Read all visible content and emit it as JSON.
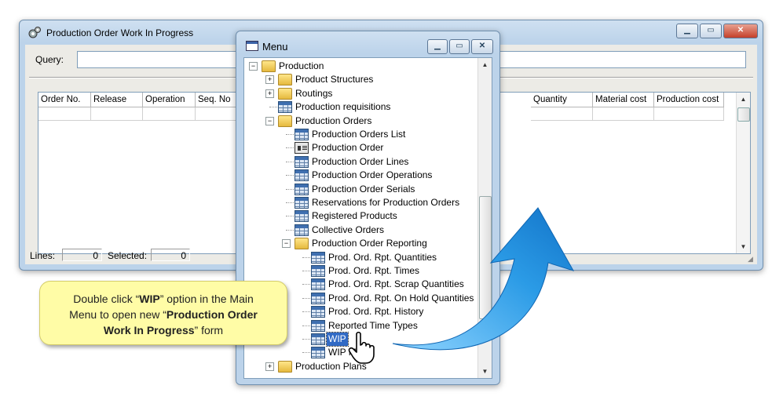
{
  "main_window": {
    "title": "Production Order Work In Progress",
    "caption_buttons": [
      "minimize",
      "maximize",
      "close"
    ],
    "query_label": "Query:",
    "query_value": "",
    "columns_left": [
      "Order No.",
      "Release",
      "Operation",
      "Seq. No"
    ],
    "columns_right": [
      "Quantity",
      "Material cost",
      "Production cost"
    ],
    "status": {
      "lines_label": "Lines:",
      "lines_value": "0",
      "selected_label": "Selected:",
      "selected_value": "0"
    }
  },
  "menu_window": {
    "title": "Menu",
    "items": [
      {
        "label": "Production",
        "icon": "folder-open-icon",
        "expander": "−",
        "level": 0
      },
      {
        "label": "Product Structures",
        "icon": "folder-icon",
        "expander": "+",
        "level": 1
      },
      {
        "label": "Routings",
        "icon": "folder-icon",
        "expander": "+",
        "level": 1
      },
      {
        "label": "Production requisitions",
        "icon": "table-icon",
        "level": 1
      },
      {
        "label": "Production Orders",
        "icon": "folder-open-icon",
        "expander": "−",
        "level": 1
      },
      {
        "label": "Production Orders List",
        "icon": "table-icon",
        "level": 2
      },
      {
        "label": "Production Order",
        "icon": "form-icon",
        "level": 2
      },
      {
        "label": "Production Order Lines",
        "icon": "table-icon",
        "level": 2
      },
      {
        "label": "Production Order Operations",
        "icon": "table-icon",
        "level": 2
      },
      {
        "label": "Production Order Serials",
        "icon": "table-icon",
        "level": 2
      },
      {
        "label": "Reservations for Production Orders",
        "icon": "table-icon",
        "level": 2
      },
      {
        "label": "Registered Products",
        "icon": "table-icon",
        "level": 2
      },
      {
        "label": "Collective Orders",
        "icon": "table-icon",
        "level": 2
      },
      {
        "label": "Production Order Reporting",
        "icon": "folder-open-icon",
        "expander": "−",
        "level": 2
      },
      {
        "label": "Prod. Ord. Rpt. Quantities",
        "icon": "table-icon",
        "level": 3
      },
      {
        "label": "Prod. Ord. Rpt. Times",
        "icon": "table-icon",
        "level": 3
      },
      {
        "label": "Prod. Ord. Rpt. Scrap Quantities",
        "icon": "table-icon",
        "level": 3
      },
      {
        "label": "Prod. Ord. Rpt. On Hold Quantities",
        "icon": "table-icon",
        "level": 3
      },
      {
        "label": "Prod. Ord. Rpt. History",
        "icon": "table-icon",
        "level": 3
      },
      {
        "label": "Reported Time Types",
        "icon": "table-icon",
        "level": 3
      },
      {
        "label": "WIP",
        "icon": "table-icon",
        "level": 3,
        "selected": true
      },
      {
        "label": "WIP M",
        "icon": "table-icon",
        "level": 3
      },
      {
        "label": "Production Plans",
        "icon": "folder-icon",
        "expander": "+",
        "level": 1
      }
    ]
  },
  "callout": {
    "line1_pre": "Double click “",
    "line1_bold": "WIP",
    "line1_post": "” option in the Main",
    "line2_pre": "Menu to open new “",
    "line2_bold": "Production Order",
    "line3_bold": "Work In Progress",
    "line3_post": "” form"
  },
  "colors": {
    "selection": "#316ac5",
    "callout_bg": "#fffca6",
    "arrow": "#1e8fe0"
  }
}
